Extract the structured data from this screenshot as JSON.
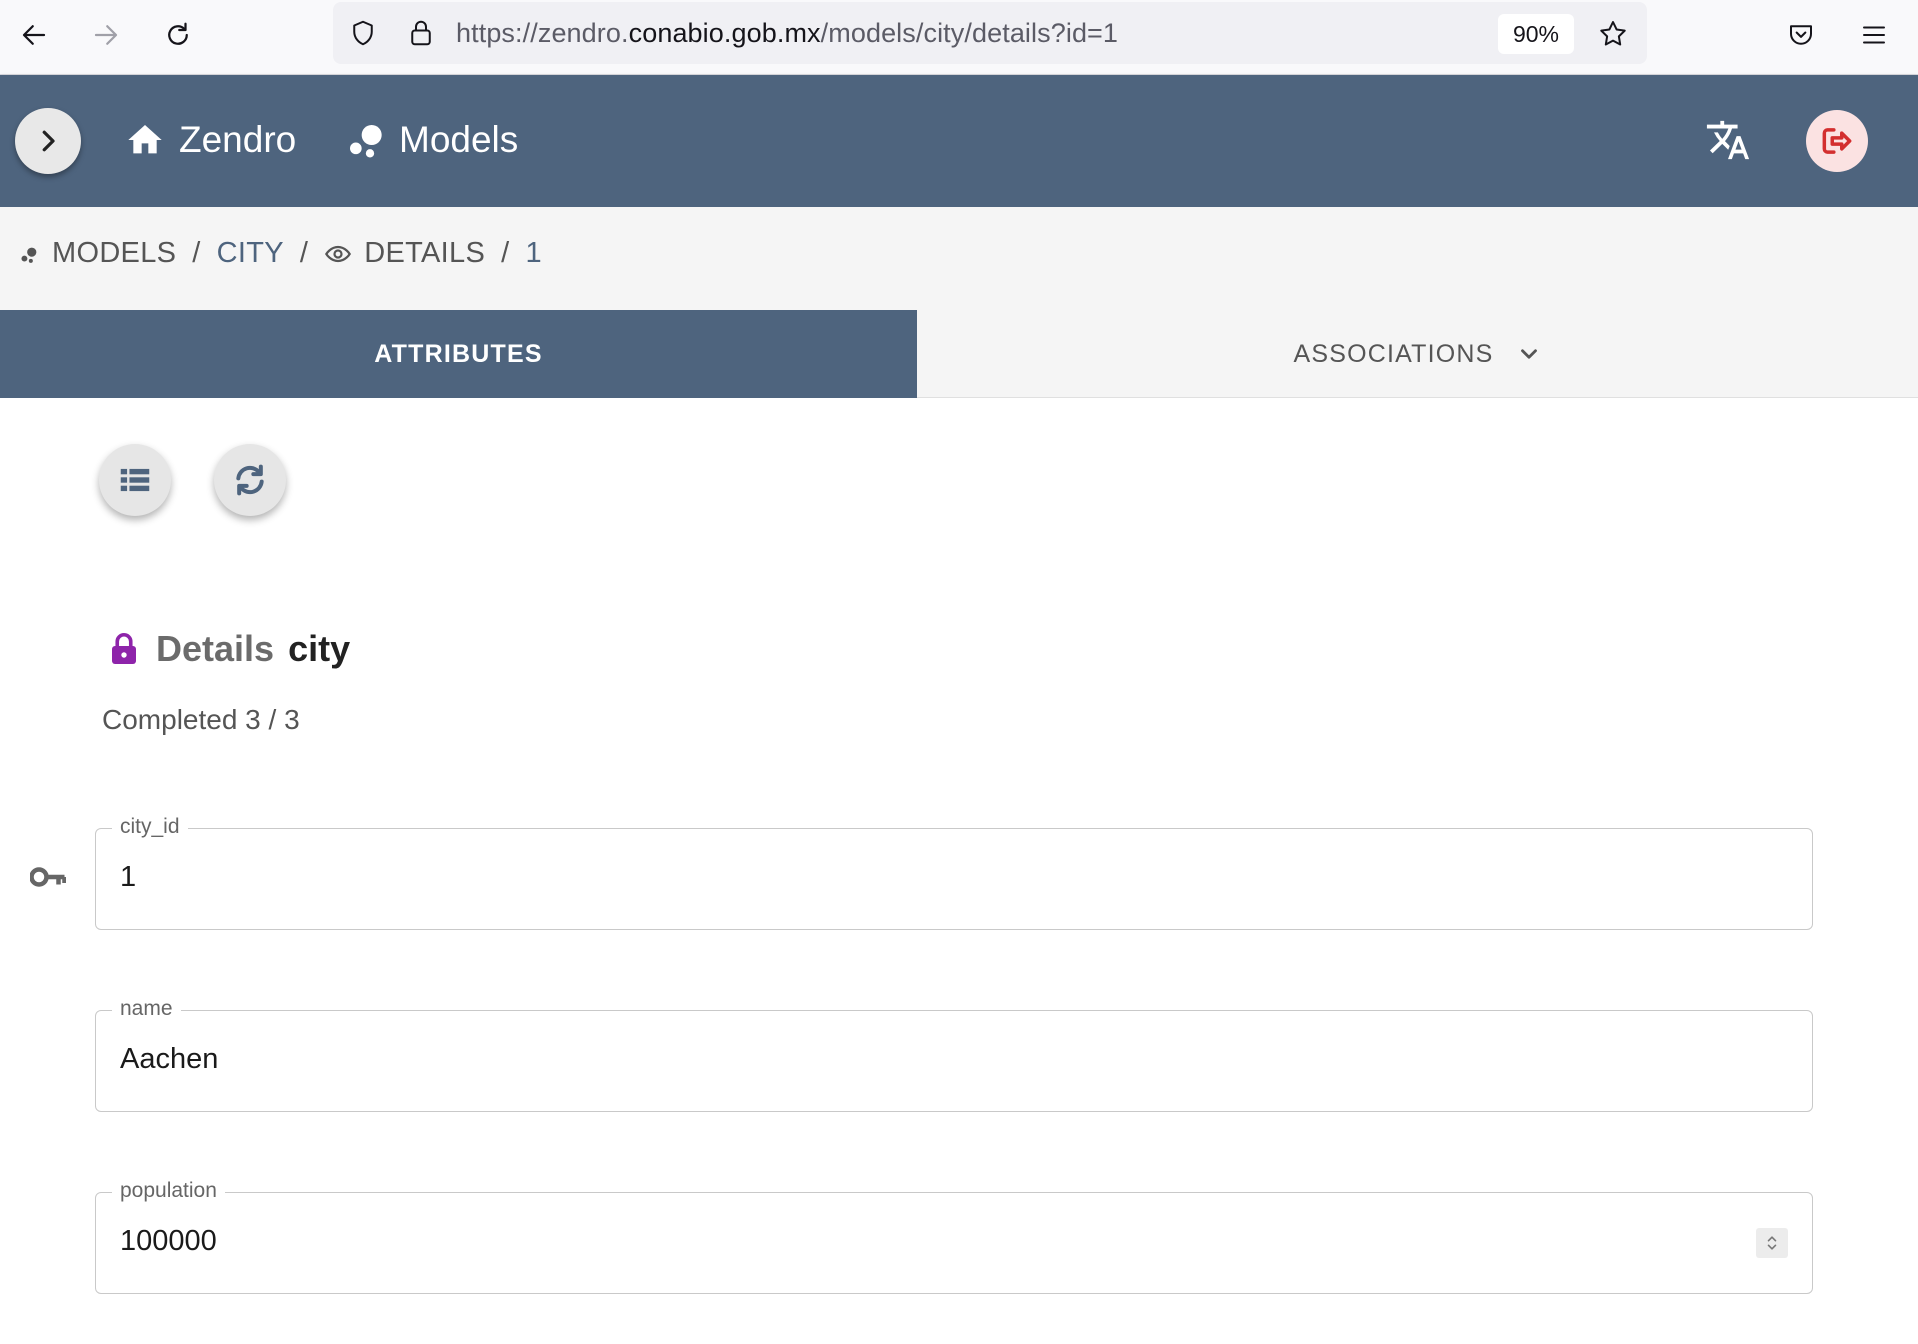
{
  "browser": {
    "url_scheme": "https://zendro.",
    "url_host": "conabio.gob.mx",
    "url_path": "/models/city/details?id=1",
    "zoom": "90%"
  },
  "header": {
    "home_label": "Zendro",
    "models_label": "Models"
  },
  "breadcrumb": {
    "models": "MODELS",
    "city": "CITY",
    "details": "DETAILS",
    "id": "1",
    "sep": "/"
  },
  "tabs": {
    "attributes": "ATTRIBUTES",
    "associations": "ASSOCIATIONS"
  },
  "details": {
    "label": "Details",
    "model": "city",
    "completed": "Completed 3 / 3"
  },
  "fields": [
    {
      "label": "city_id",
      "value": "1"
    },
    {
      "label": "name",
      "value": "Aachen"
    },
    {
      "label": "population",
      "value": "100000"
    }
  ],
  "colors": {
    "header_bg": "#4e647e",
    "lock_icon": "#8e24aa",
    "logout_icon": "#d32f2f"
  }
}
